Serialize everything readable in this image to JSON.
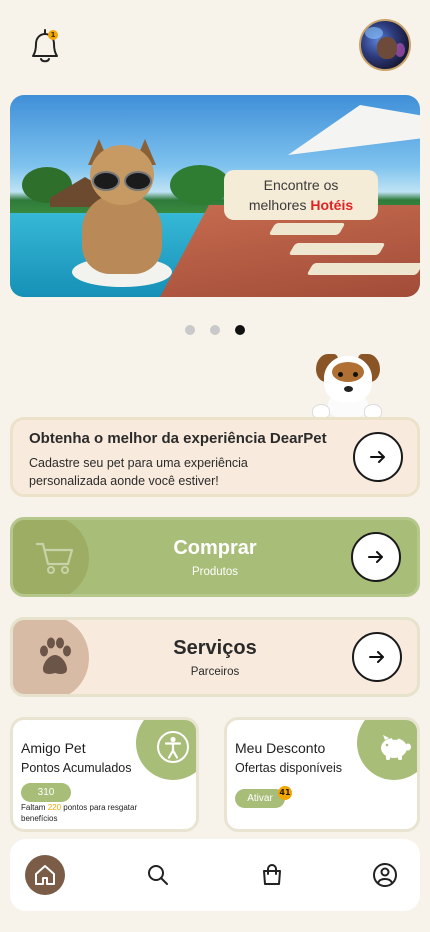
{
  "header": {
    "notifications_count": "1",
    "bell_icon": "bell-icon",
    "avatar": "user-avatar"
  },
  "banner": {
    "text_line1": "Encontre os",
    "text_line2": "melhores",
    "text_highlight": "Hotéis",
    "highlight_color": "#e02222",
    "slides": 3,
    "active_slide": 3
  },
  "info_card": {
    "title": "Obtenha o melhor da experiência DearPet",
    "description": "Cadastre seu pet para uma experiência personalizada aonde você estiver!",
    "icon": "arrow-right-icon"
  },
  "actions": {
    "buy": {
      "title": "Comprar",
      "subtitle": "Produtos",
      "icon": "cart-icon",
      "color": "#a8bd78"
    },
    "services": {
      "title": "Serviços",
      "subtitle": "Parceiros",
      "icon": "paw-icon",
      "color": "#f8ebdd"
    }
  },
  "amigo_pet": {
    "title": "Amigo Pet",
    "subtitle": "Pontos Acumulados",
    "points": "310",
    "note_prefix": "Faltam",
    "note_points": "220",
    "note_suffix": "pontos para resgatar benefícios",
    "icon": "person-icon"
  },
  "desconto": {
    "title": "Meu Desconto",
    "subtitle": "Ofertas disponíveis",
    "button": "Ativar",
    "count": "41",
    "icon": "piggy-bank-icon"
  },
  "bottom_nav": {
    "items": [
      "home-icon",
      "search-icon",
      "bag-icon",
      "profile-icon"
    ],
    "active": "home-icon",
    "accent": "#7a5c47"
  }
}
